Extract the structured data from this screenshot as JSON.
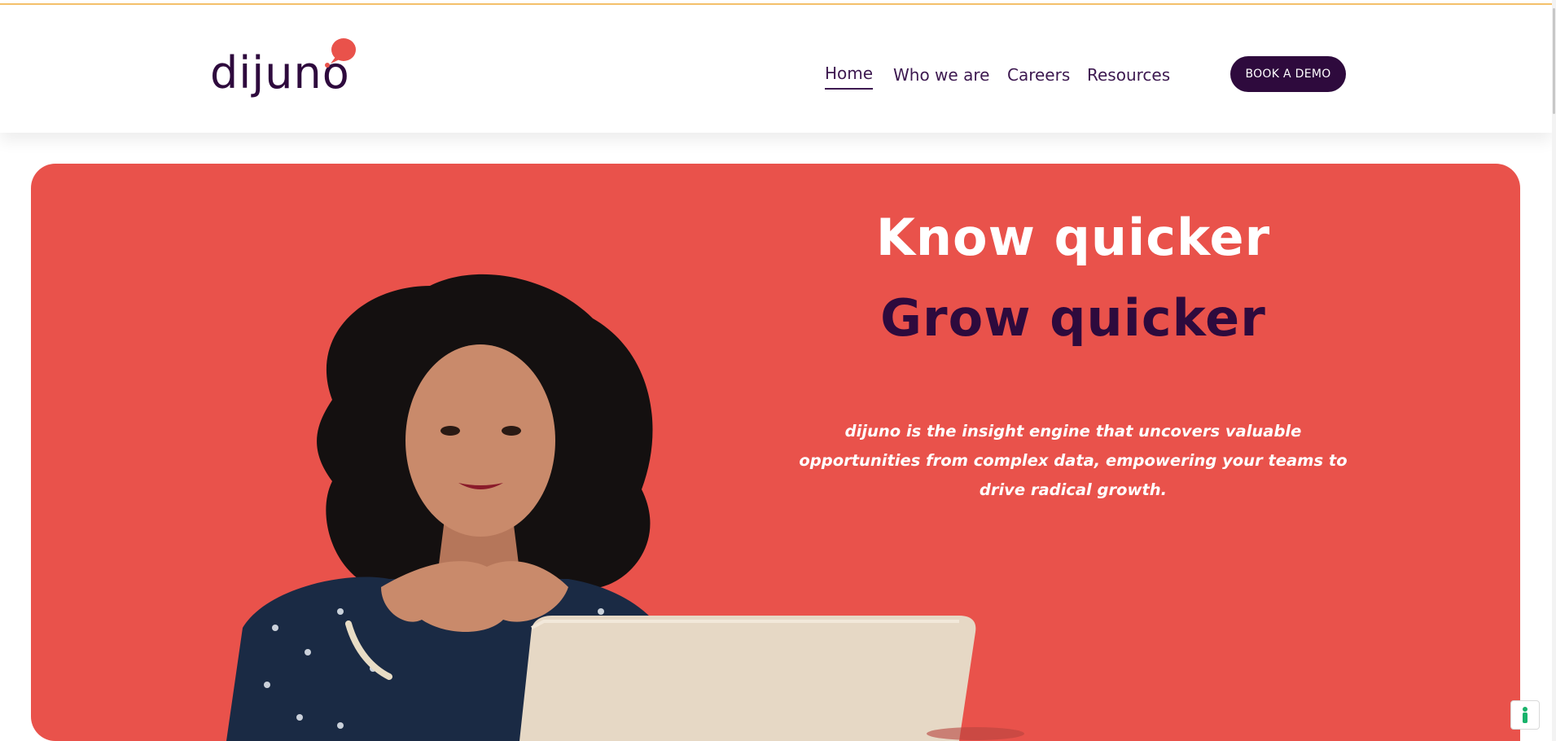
{
  "brand": {
    "name": "dijuno",
    "accent_color": "#e9524b",
    "dark_color": "#2e0a3d"
  },
  "nav": {
    "items": [
      {
        "label": "Home",
        "active": true
      },
      {
        "label": "Who we are",
        "active": false
      },
      {
        "label": "Careers",
        "active": false
      },
      {
        "label": "Resources",
        "active": false
      }
    ],
    "cta_label": "BOOK A DEMO"
  },
  "hero": {
    "headline_1": "Know quicker",
    "headline_2": "Grow quicker",
    "tagline_lines": [
      "dijuno is the insight engine that uncovers valuable",
      "opportunities from complex data, empowering your teams to",
      "drive radical growth."
    ],
    "image": "woman-at-laptop-photo"
  },
  "widget": {
    "icon": "accessibility-icon"
  }
}
